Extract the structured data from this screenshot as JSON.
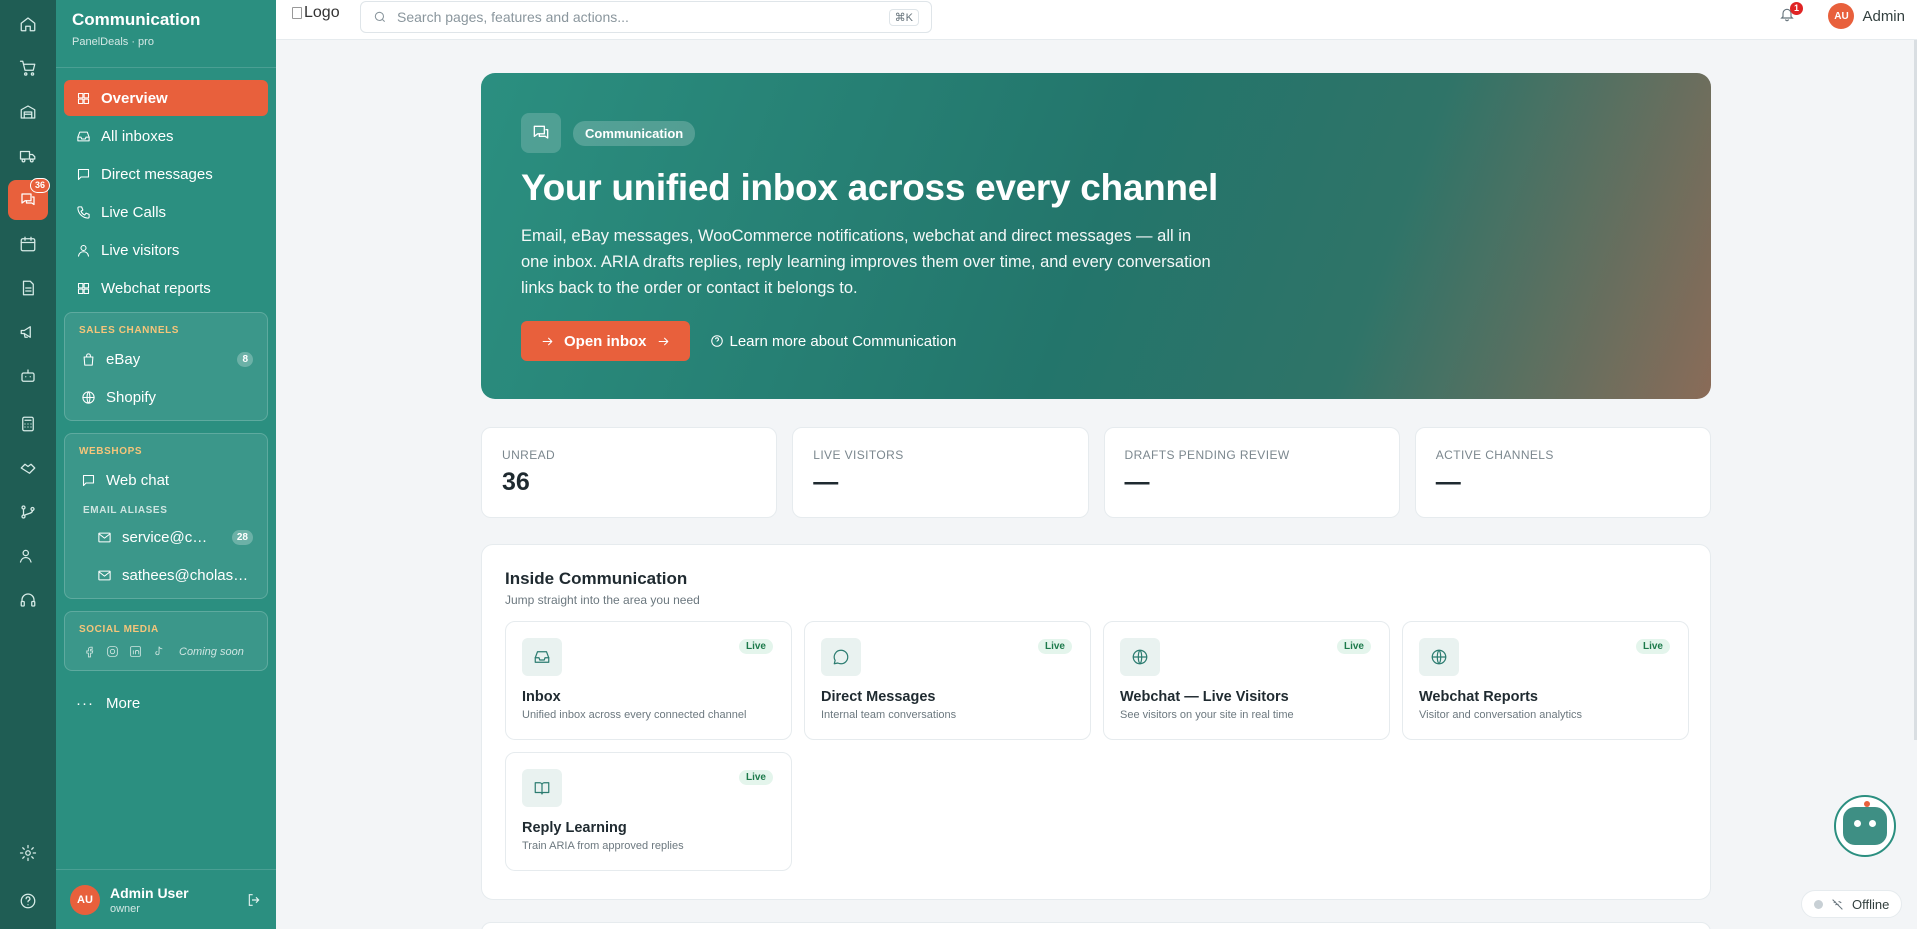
{
  "rail": {
    "items": [
      {
        "icon": "home-icon"
      },
      {
        "icon": "cart-icon"
      },
      {
        "icon": "warehouse-icon"
      },
      {
        "icon": "truck-icon"
      },
      {
        "icon": "chat-icon",
        "active": true,
        "badge": "36"
      },
      {
        "icon": "calendar-icon"
      },
      {
        "icon": "document-icon"
      },
      {
        "icon": "megaphone-icon"
      },
      {
        "icon": "robot-icon"
      },
      {
        "icon": "calculator-icon"
      },
      {
        "icon": "handshake-icon"
      },
      {
        "icon": "git-branch-icon"
      },
      {
        "icon": "users-icon"
      },
      {
        "icon": "headset-icon"
      }
    ],
    "bottom": [
      {
        "icon": "settings-icon"
      },
      {
        "icon": "help-icon"
      }
    ]
  },
  "sidebar": {
    "title": "Communication",
    "subtitle": "PanelDeals · pro",
    "nav": [
      {
        "label": "Overview",
        "icon": "grid-icon",
        "active": true
      },
      {
        "label": "All inboxes",
        "icon": "inbox-icon"
      },
      {
        "label": "Direct messages",
        "icon": "message-icon"
      },
      {
        "label": "Live Calls",
        "icon": "phone-icon"
      },
      {
        "label": "Live visitors",
        "icon": "user-icon"
      },
      {
        "label": "Webchat reports",
        "icon": "grid-icon"
      }
    ],
    "sales_channels": {
      "label": "SALES CHANNELS",
      "items": [
        {
          "label": "eBay",
          "count": "8",
          "icon": "bag-icon"
        },
        {
          "label": "Shopify",
          "icon": "globe-icon"
        }
      ]
    },
    "webshops": {
      "label": "WEBSHOPS",
      "web_chat": "Web chat",
      "email_aliases_label": "EMAIL ALIASES",
      "aliases": [
        {
          "label": "service@cholasxi.com",
          "count": "28"
        },
        {
          "label": "sathees@cholasxi.com"
        }
      ]
    },
    "social": {
      "label": "SOCIAL MEDIA",
      "icons": [
        "facebook-icon",
        "instagram-icon",
        "linkedin-icon",
        "tiktok-icon"
      ],
      "coming_soon": "Coming soon"
    },
    "more": "More",
    "user": {
      "initials": "AU",
      "name": "Admin User",
      "role": "owner"
    }
  },
  "topbar": {
    "logo_alt": "Logo",
    "search_placeholder": "Search pages, features and actions...",
    "shortcut": "⌘K",
    "notifications": "1",
    "user_initials": "AU",
    "user_name": "Admin"
  },
  "hero": {
    "tag": "Communication",
    "title": "Your unified inbox across every channel",
    "description": "Email, eBay messages, WooCommerce notifications, webchat and direct messages — all in one inbox. ARIA drafts replies, reply learning improves them over time, and every conversation links back to the order or contact it belongs to.",
    "primary_button": "Open inbox",
    "secondary_link": "Learn more about Communication"
  },
  "stats": [
    {
      "label": "UNREAD",
      "value": "36"
    },
    {
      "label": "LIVE VISITORS",
      "value": "—"
    },
    {
      "label": "DRAFTS PENDING REVIEW",
      "value": "—"
    },
    {
      "label": "ACTIVE CHANNELS",
      "value": "—"
    }
  ],
  "inside": {
    "title": "Inside Communication",
    "subtitle": "Jump straight into the area you need",
    "cards": [
      {
        "title": "Inbox",
        "desc": "Unified inbox across every connected channel",
        "badge": "Live",
        "icon": "inbox-icon"
      },
      {
        "title": "Direct Messages",
        "desc": "Internal team conversations",
        "badge": "Live",
        "icon": "message-circle-icon"
      },
      {
        "title": "Webchat — Live Visitors",
        "desc": "See visitors on your site in real time",
        "badge": "Live",
        "icon": "globe-icon"
      },
      {
        "title": "Webchat Reports",
        "desc": "Visitor and conversation analytics",
        "badge": "Live",
        "icon": "globe-icon"
      },
      {
        "title": "Reply Learning",
        "desc": "Train ARIA from approved replies",
        "badge": "Live",
        "icon": "book-icon"
      }
    ]
  },
  "status": {
    "offline": "Offline"
  },
  "colors": {
    "accent": "#e8603c",
    "sidebar": "#2b8f80",
    "rail": "#1f5d54"
  }
}
